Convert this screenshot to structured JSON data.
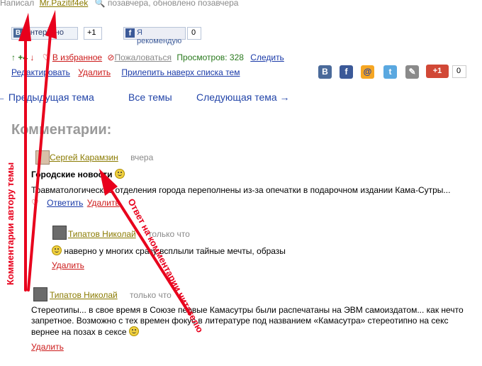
{
  "author": {
    "prefix": "Написал",
    "name": "Mr.Pazitif4ek",
    "time": "позавчера, обновлено позавчера"
  },
  "social": {
    "vk_label": "Интересно",
    "vk_count": "+1",
    "fb_label": "Я рекомендую",
    "fb_count": "0",
    "gplus_label": "+1",
    "gplus_count": "0"
  },
  "actions": {
    "rating": "+4",
    "favorite": "В избранное",
    "complain": "Пожаловаться",
    "views": "Просмотров: 328",
    "follow": "Следить",
    "edit": "Редактировать",
    "delete": "Удалить",
    "pin": "Прилепить наверх списка тем"
  },
  "nav": {
    "prev": "← Предыдущая тема",
    "all": "Все темы",
    "next": "Следующая тема →"
  },
  "comments_heading": "Комментарии:",
  "comments": [
    {
      "author": "Сергей Карамзин",
      "time": "вчера",
      "title": "Городские новости",
      "text": "Травматологические отделения города переполнены из-за опечатки в подарочном издании Кама-Сутры...",
      "reply": "Ответить",
      "delete": "Удалить"
    },
    {
      "author": "Типатов Николай",
      "time": "только что",
      "text": "наверно у многих сразу всплыли тайные мечты, образы",
      "delete": "Удалить"
    },
    {
      "author": "Типатов Николай",
      "time": "только что",
      "text_line1": "Стереотипы... в свое время в Союзе первые Камасутры были распечатаны на ЭВМ самоиздатом... как нечто",
      "text_line2": "запретное. Возможно с тех времен фокус в литературе под названием «Камасутра» стереотипно на секс",
      "text_line3": "вернее на позах в сексе",
      "delete": "Удалить"
    }
  ],
  "annotations": {
    "topic_author": "Комментарии автору темы",
    "reader_reply": "Ответ на комментарии читателю"
  },
  "colors": {
    "link": "#1a3aa8",
    "red": "#cc1a1a",
    "annotation": "#e8001c",
    "heading": "#9a9a9a"
  }
}
